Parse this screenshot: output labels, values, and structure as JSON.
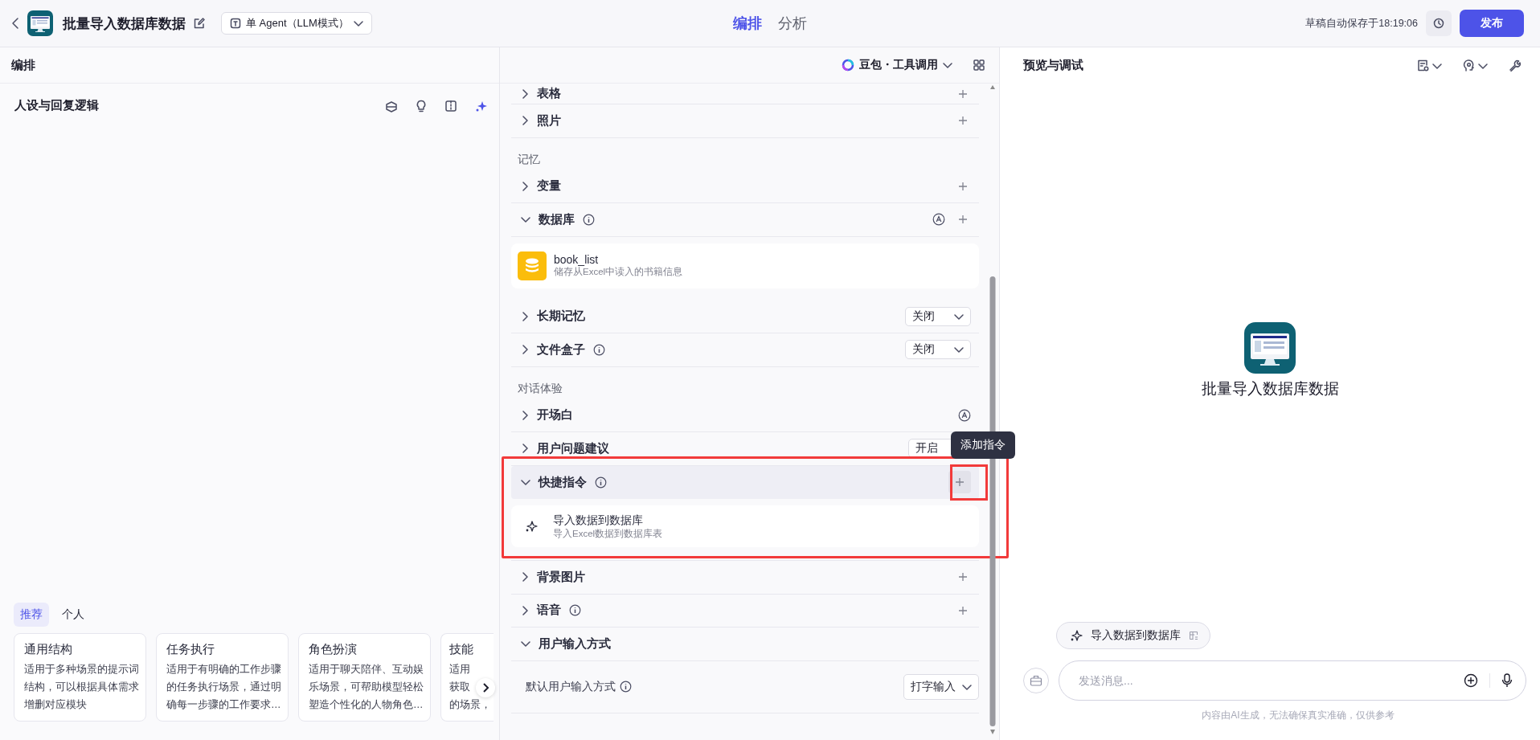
{
  "topbar": {
    "title": "批量导入数据库数据",
    "mode": "单 Agent（LLM模式）",
    "tabs": [
      {
        "label": "编排",
        "selected": true
      },
      {
        "label": "分析",
        "selected": false
      }
    ],
    "save_status": "草稿自动保存于18:19:06",
    "publish": "发布"
  },
  "editor_header": {
    "title": "编排",
    "model": "豆包・工具调用"
  },
  "persona": {
    "title": "人设与回复逻辑",
    "tabs": [
      {
        "label": "推荐",
        "selected": true
      },
      {
        "label": "个人",
        "selected": false
      }
    ],
    "templates": [
      {
        "title": "通用结构",
        "lines": [
          "适用于多种场景的提示词",
          "结构，可以根据具体需求",
          "增删对应模块"
        ]
      },
      {
        "title": "任务执行",
        "lines": [
          "适用于有明确的工作步骤",
          "的任务执行场景，通过明",
          "确每一步骤的工作要求…"
        ]
      },
      {
        "title": "角色扮演",
        "lines": [
          "适用于聊天陪伴、互动娱",
          "乐场景，可帮助模型轻松",
          "塑造个性化的人物角色…"
        ]
      },
      {
        "title": "技能",
        "lines": [
          "适用",
          "获取",
          "的场景，"
        ],
        "cut": true
      }
    ]
  },
  "skills": {
    "items": [
      {
        "kind": "row",
        "label": "表格",
        "expanded": false,
        "add": true
      },
      {
        "kind": "row",
        "label": "照片",
        "expanded": false,
        "add": true
      },
      {
        "kind": "group",
        "label": "记忆"
      },
      {
        "kind": "row",
        "label": "变量",
        "expanded": false,
        "add": true
      },
      {
        "kind": "row",
        "label": "数据库",
        "expanded": true,
        "info": true,
        "auto": true,
        "add": true
      },
      {
        "kind": "database",
        "name": "book_list",
        "description": "储存从Excel中读入的书籍信息"
      },
      {
        "kind": "row",
        "label": "长期记忆",
        "expanded": false,
        "select": "关闭"
      },
      {
        "kind": "row",
        "label": "文件盒子",
        "expanded": false,
        "info": true,
        "select": "关闭"
      },
      {
        "kind": "group",
        "label": "对话体验"
      },
      {
        "kind": "row",
        "label": "开场白",
        "expanded": false,
        "auto": true
      },
      {
        "kind": "row",
        "label": "用户问题建议",
        "expanded": false,
        "select": "开启"
      },
      {
        "kind": "shortcut",
        "label": "快捷指令",
        "expanded": true,
        "info": true,
        "hovered": true,
        "marked": true,
        "tooltip": "添加指令",
        "commands": [
          {
            "name": "导入数据到数据库",
            "description": "导入Excel数据到数据库表"
          }
        ]
      },
      {
        "kind": "row",
        "label": "背景图片",
        "expanded": false,
        "add": true
      },
      {
        "kind": "row",
        "label": "语音",
        "expanded": false,
        "info": true,
        "add": true
      },
      {
        "kind": "row",
        "label": "用户输入方式",
        "expanded": true
      },
      {
        "kind": "setting",
        "label": "默认用户输入方式",
        "info": true,
        "select": "打字输入"
      }
    ]
  },
  "preview": {
    "title": "预览与调试",
    "bot_name": "批量导入数据库数据",
    "shortcut_chip": "导入数据到数据库",
    "input_placeholder": "发送消息...",
    "disclaimer": "内容由AI生成，无法确保真实准确，仅供参考"
  }
}
